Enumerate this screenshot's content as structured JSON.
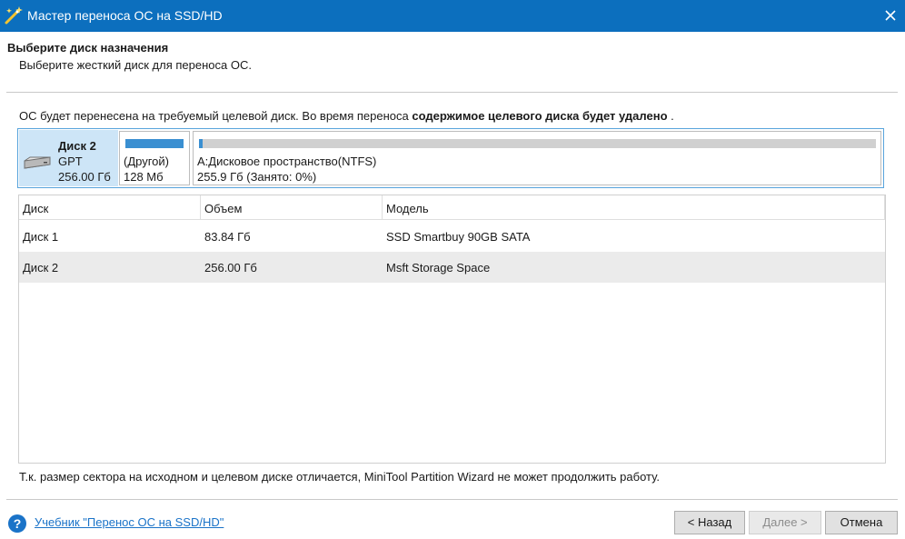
{
  "window": {
    "title": "Мастер переноса ОС на SSD/HD",
    "titlebar_color": "#0c6fbe"
  },
  "step": {
    "heading": "Выберите диск назначения",
    "subheading": "Выберите жесткий диск для переноса ОС."
  },
  "notice": {
    "prefix": "ОС будет перенесена на требуемый целевой диск. Во время переноса ",
    "bold": "содержимое целевого диска будет удалено",
    "suffix": " ."
  },
  "disk_map": {
    "name": "Диск 2",
    "type": "GPT",
    "size": "256.00 Гб",
    "icon": "hard-drive-icon",
    "partitions": [
      {
        "label": "(Другой)",
        "size": "128 Мб",
        "used_fraction": 1.0
      },
      {
        "label": "A:Дисковое пространство(NTFS)",
        "size": "255.9 Гб (Занято: 0%)",
        "used_fraction": 0.0
      }
    ]
  },
  "table": {
    "columns": [
      "Диск",
      "Объем",
      "Модель"
    ],
    "rows": [
      {
        "disk": "Диск 1",
        "capacity": "83.84 Гб",
        "model": "SSD Smartbuy 90GB SATA",
        "selected": false
      },
      {
        "disk": "Диск 2",
        "capacity": "256.00 Гб",
        "model": "Msft Storage Space",
        "selected": true
      }
    ]
  },
  "warning": "Т.к. размер сектора на исходном и целевом диске отличается, MiniTool Partition Wizard не может продолжить работу.",
  "footer": {
    "help_link": "Учебник \"Перенос ОС на SSD/HD\"",
    "help_icon": "question-circle-icon",
    "back_label": "< Назад",
    "next_label": "Далее >",
    "cancel_label": "Отмена",
    "next_enabled": false
  },
  "colors": {
    "accent": "#0c6fbe",
    "selected_disk_bg": "#cde5f7",
    "partition_used": "#3a8fd1",
    "partition_free": "#d0d0d0",
    "link": "#1a73c8"
  }
}
